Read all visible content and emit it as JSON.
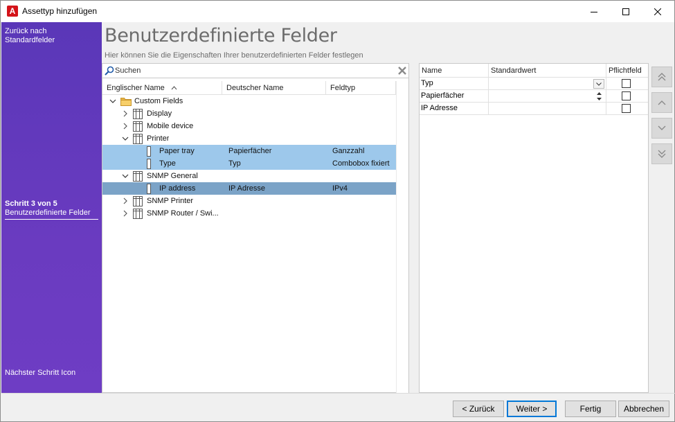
{
  "window": {
    "title": "Assettyp hinzufügen",
    "app_icon_letter": "A"
  },
  "sidebar": {
    "back_label": "Zurück nach Standardfelder",
    "step_number": "Schritt 3 von 5",
    "step_name": "Benutzerdefinierte Felder",
    "next_label": "Nächster Schritt Icon"
  },
  "header": {
    "title": "Benutzerdefinierte Felder",
    "subtitle": "Hier können Sie die Eigenschaften Ihrer benutzerdefinierten Felder festlegen"
  },
  "search": {
    "placeholder": "Suchen"
  },
  "tree": {
    "columns": [
      "Englischer Name",
      "Deutscher Name",
      "Feldtyp"
    ],
    "root": "Custom Fields",
    "rows": [
      {
        "en": "Custom Fields",
        "de": "",
        "type": "",
        "level": 0,
        "kind": "folder",
        "expanded": true
      },
      {
        "en": "Display",
        "de": "",
        "type": "",
        "level": 1,
        "kind": "table",
        "expanded": false
      },
      {
        "en": "Mobile device",
        "de": "",
        "type": "",
        "level": 1,
        "kind": "table",
        "expanded": false
      },
      {
        "en": "Printer",
        "de": "",
        "type": "",
        "level": 1,
        "kind": "table",
        "expanded": true
      },
      {
        "en": "Paper tray",
        "de": "Papierfächer",
        "type": "Ganzzahl",
        "level": 2,
        "kind": "field",
        "selected": "light"
      },
      {
        "en": "Type",
        "de": "Typ",
        "type": "Combobox fixiert",
        "level": 2,
        "kind": "field",
        "selected": "light"
      },
      {
        "en": "SNMP General",
        "de": "",
        "type": "",
        "level": 1,
        "kind": "table",
        "expanded": true
      },
      {
        "en": "IP address",
        "de": "IP Adresse",
        "type": "IPv4",
        "level": 2,
        "kind": "field",
        "selected": "dark"
      },
      {
        "en": "SNMP Printer",
        "de": "",
        "type": "",
        "level": 1,
        "kind": "table",
        "expanded": false
      },
      {
        "en": "SNMP Router / Swi...",
        "de": "",
        "type": "",
        "level": 1,
        "kind": "table",
        "expanded": false
      }
    ]
  },
  "grid": {
    "columns": [
      "Name",
      "Standardwert",
      "Pflichtfeld"
    ],
    "rows": [
      {
        "name": "Typ",
        "default": "",
        "editor": "combo",
        "required": false
      },
      {
        "name": "Papierfächer",
        "default": "",
        "editor": "spin",
        "required": false
      },
      {
        "name": "IP Adresse",
        "default": "",
        "editor": "text",
        "required": false
      }
    ]
  },
  "order_buttons": [
    "move-top",
    "move-up",
    "move-down",
    "move-bottom"
  ],
  "footer": {
    "back": "< Zurück",
    "next": "Weiter >",
    "finish": "Fertig",
    "cancel": "Abbrechen"
  },
  "colors": {
    "sidebar": "#5a37b8",
    "selected_light": "#9dc8eb",
    "selected_dark": "#7ba3c7",
    "app_icon": "#d4141a"
  }
}
